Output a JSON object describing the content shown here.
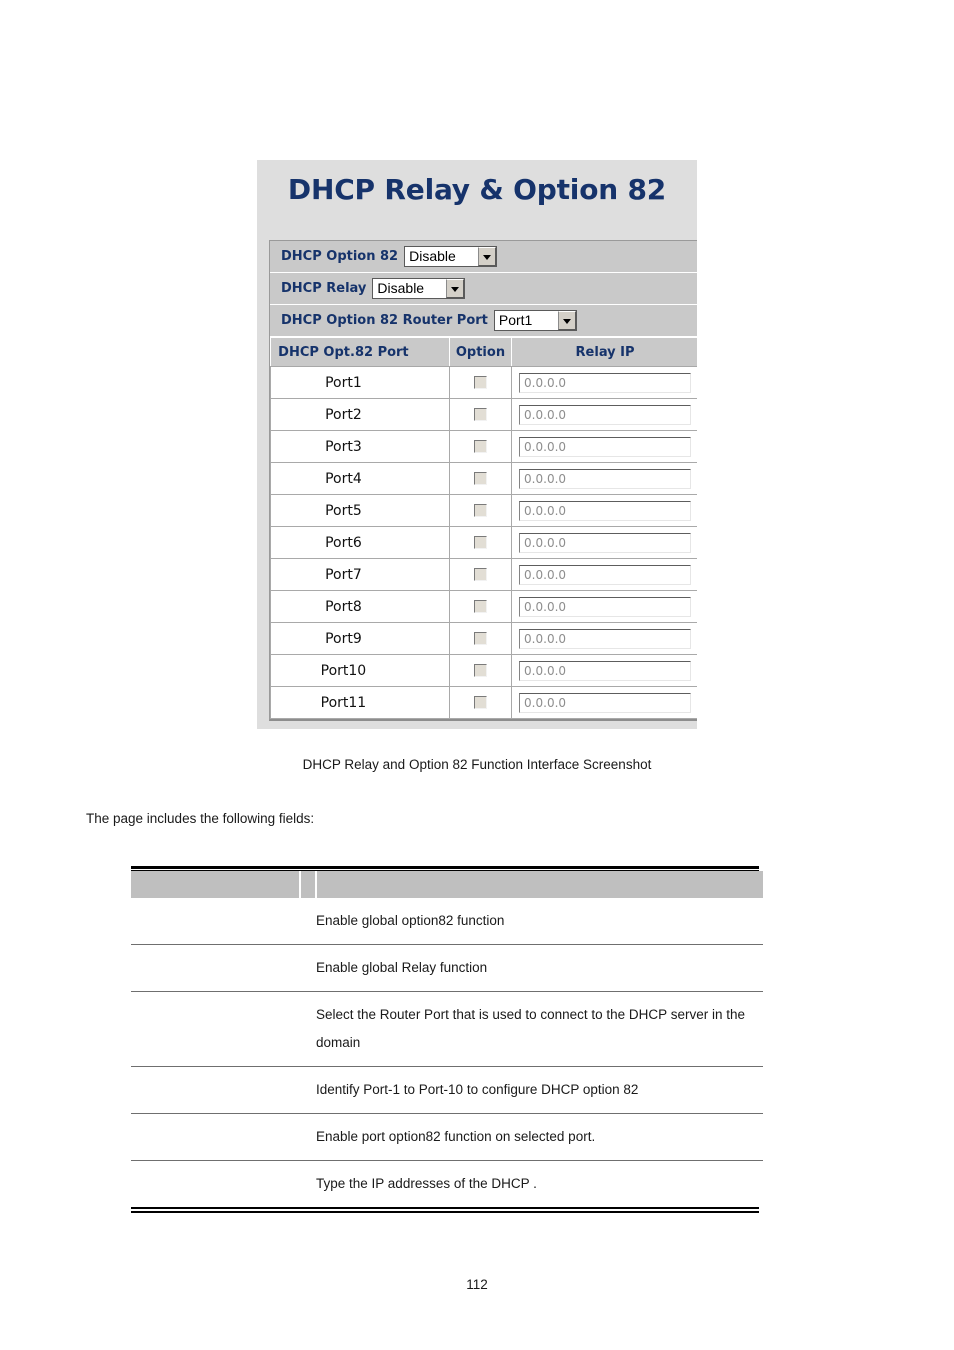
{
  "document": {
    "figure_caption": "DHCP Relay and Option 82 Function Interface Screenshot",
    "lead_text": "The page includes the following fields:",
    "page_number": "112"
  },
  "device_ui": {
    "title": "DHCP Relay & Option 82",
    "global_settings": [
      {
        "label": "DHCP Option 82",
        "value": "Disable"
      },
      {
        "label": "DHCP Relay",
        "value": "Disable"
      },
      {
        "label": "DHCP Option 82 Router Port",
        "value": "Port1"
      }
    ],
    "port_table": {
      "headers": [
        "DHCP Opt.82 Port",
        "Option",
        "Relay IP"
      ],
      "rows": [
        {
          "port": "Port1",
          "option": false,
          "relay_ip": "0.0.0.0"
        },
        {
          "port": "Port2",
          "option": false,
          "relay_ip": "0.0.0.0"
        },
        {
          "port": "Port3",
          "option": false,
          "relay_ip": "0.0.0.0"
        },
        {
          "port": "Port4",
          "option": false,
          "relay_ip": "0.0.0.0"
        },
        {
          "port": "Port5",
          "option": false,
          "relay_ip": "0.0.0.0"
        },
        {
          "port": "Port6",
          "option": false,
          "relay_ip": "0.0.0.0"
        },
        {
          "port": "Port7",
          "option": false,
          "relay_ip": "0.0.0.0"
        },
        {
          "port": "Port8",
          "option": false,
          "relay_ip": "0.0.0.0"
        },
        {
          "port": "Port9",
          "option": false,
          "relay_ip": "0.0.0.0"
        },
        {
          "port": "Port10",
          "option": false,
          "relay_ip": "0.0.0.0"
        },
        {
          "port": "Port11",
          "option": false,
          "relay_ip": "0.0.0.0"
        }
      ]
    },
    "colors": {
      "title_text": "#16336b",
      "panel_background": "#dedede",
      "table_header_background": "#c9c9c9"
    }
  },
  "field_table": {
    "headers": [
      "",
      "",
      ""
    ],
    "rows": [
      {
        "name": "",
        "spacer": "",
        "description": "Enable global option82 function"
      },
      {
        "name": "",
        "spacer": "",
        "description": "Enable global Relay function"
      },
      {
        "name": "",
        "spacer": "",
        "description": "Select the Router Port that is used to connect to the DHCP server in the domain"
      },
      {
        "name": "",
        "spacer": "",
        "description": "Identify Port-1 to Port-10 to configure DHCP option 82"
      },
      {
        "name": "",
        "spacer": "",
        "description": "Enable port option82 function on selected port."
      },
      {
        "name": "",
        "spacer": "",
        "description": "Type the IP addresses of the DHCP            ."
      }
    ]
  }
}
